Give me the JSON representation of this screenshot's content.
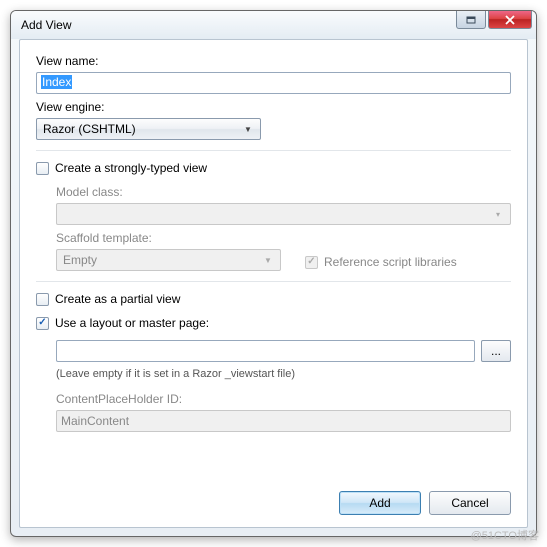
{
  "window": {
    "title": "Add View"
  },
  "viewName": {
    "label": "View name:",
    "value": "Index"
  },
  "viewEngine": {
    "label": "View engine:",
    "value": "Razor (CSHTML)"
  },
  "stronglyTyped": {
    "label": "Create a strongly-typed view",
    "modelClassLabel": "Model class:",
    "modelClassValue": "",
    "scaffoldLabel": "Scaffold template:",
    "scaffoldValue": "Empty",
    "refScriptLabel": "Reference script libraries"
  },
  "partial": {
    "label": "Create as a partial view"
  },
  "layout": {
    "label": "Use a layout or master page:",
    "value": "",
    "browseLabel": "...",
    "note": "(Leave empty if it is set in a Razor _viewstart file)",
    "cphLabel": "ContentPlaceHolder ID:",
    "cphValue": "MainContent"
  },
  "buttons": {
    "add": "Add",
    "cancel": "Cancel"
  },
  "watermark": "@51CTO博客"
}
